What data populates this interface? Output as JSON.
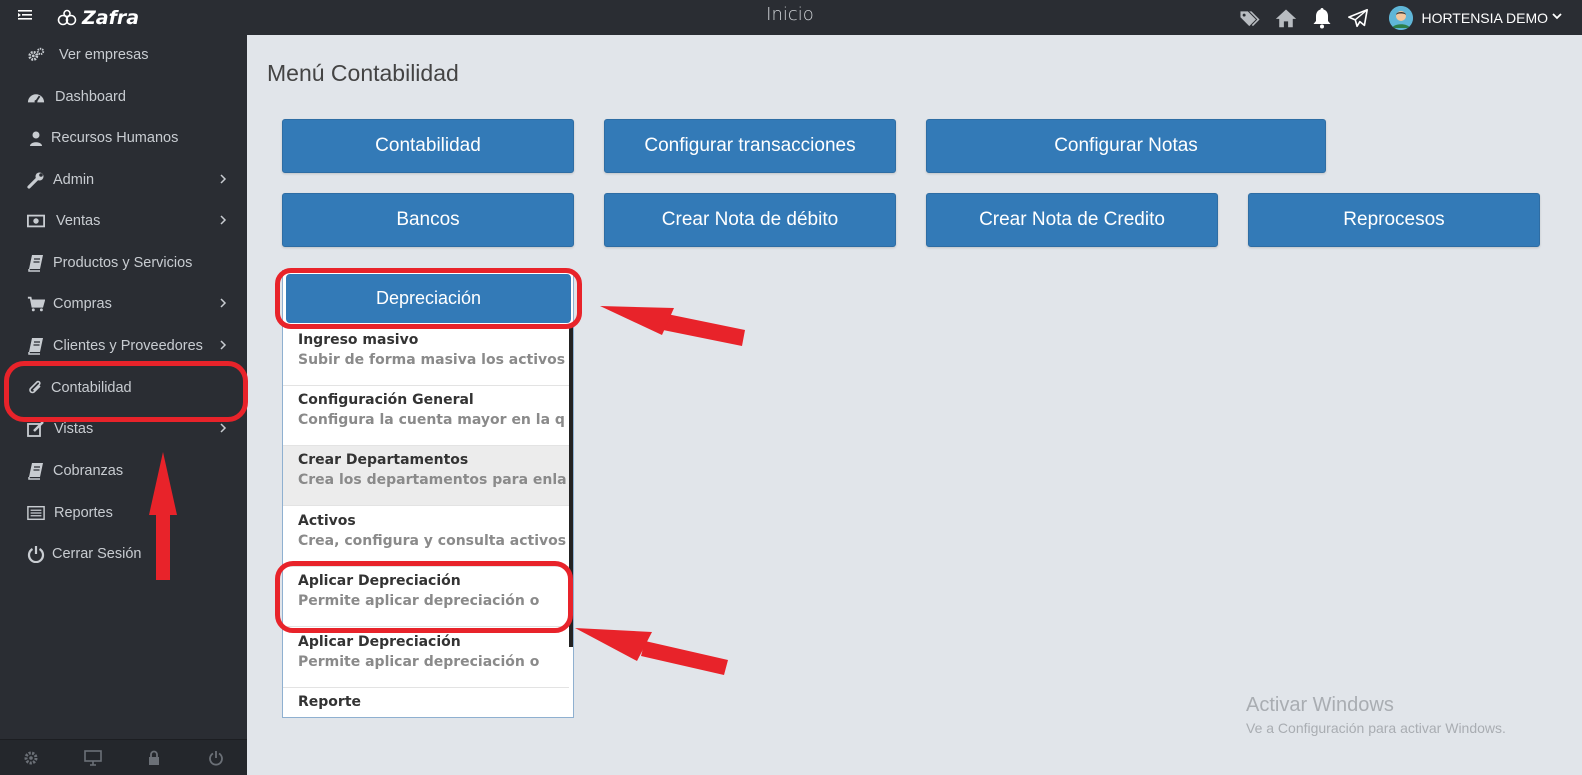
{
  "header": {
    "brand": "Zafra",
    "title": "Inicio",
    "user_name": "HORTENSIA DEMO",
    "icons": [
      "tags-icon",
      "home-icon",
      "bell-icon",
      "paper-plane-icon"
    ]
  },
  "sidebar": {
    "items": [
      {
        "label": "Ver empresas",
        "icon": "cogs-icon",
        "chevron": false
      },
      {
        "label": "Dashboard",
        "icon": "dashboard-icon",
        "chevron": false
      },
      {
        "label": "Recursos Humanos",
        "icon": "user-icon",
        "chevron": false
      },
      {
        "label": "Admin",
        "icon": "wrench-icon",
        "chevron": true
      },
      {
        "label": "Ventas",
        "icon": "money-icon",
        "chevron": true
      },
      {
        "label": "Productos y Servicios",
        "icon": "book-icon",
        "chevron": false
      },
      {
        "label": "Compras",
        "icon": "cart-icon",
        "chevron": true
      },
      {
        "label": "Clientes y Proveedores",
        "icon": "book-icon",
        "chevron": true
      },
      {
        "label": "Contabilidad",
        "icon": "paperclip-icon",
        "chevron": false
      },
      {
        "label": "Vistas",
        "icon": "edit-icon",
        "chevron": true
      },
      {
        "label": "Cobranzas",
        "icon": "book-icon",
        "chevron": false
      },
      {
        "label": "Reportes",
        "icon": "list-icon",
        "chevron": false
      },
      {
        "label": "Cerrar Sesión",
        "icon": "power-icon",
        "chevron": false
      }
    ],
    "footer_icons": [
      "settings-icon",
      "monitor-icon",
      "lock-icon",
      "power-icon"
    ]
  },
  "main": {
    "title": "Menú Contabilidad",
    "buttons": [
      "Contabilidad",
      "Configurar transacciones",
      "Configurar Notas",
      "Bancos",
      "Crear Nota de débito",
      "Crear Nota de Credito",
      "Reprocesos"
    ],
    "dropdown": {
      "title": "Depreciación",
      "items": [
        {
          "title": "Ingreso masivo",
          "subtitle": "Subir de forma masiva los activos."
        },
        {
          "title": "Configuración General",
          "subtitle": "Configura la cuenta mayor en la que"
        },
        {
          "title": "Crear Departamentos",
          "subtitle": "Crea los departamentos para enlazar"
        },
        {
          "title": "Activos",
          "subtitle": "Crea, configura y consulta activos."
        },
        {
          "title": "Aplicar Depreciación",
          "subtitle": "Permite aplicar depreciación o"
        },
        {
          "title": "Aplicar Depreciación",
          "subtitle": "Permite aplicar depreciación o"
        },
        {
          "title": "Reporte",
          "subtitle": ""
        }
      ]
    }
  },
  "watermark": {
    "line1": "Activar Windows",
    "line2": "Ve a Configuración para activar Windows."
  },
  "colors": {
    "primary_button": "#337ab7",
    "sidebar_bg": "#2a2d33",
    "annotation": "#e8232a",
    "page_bg": "#e1e5ea"
  }
}
